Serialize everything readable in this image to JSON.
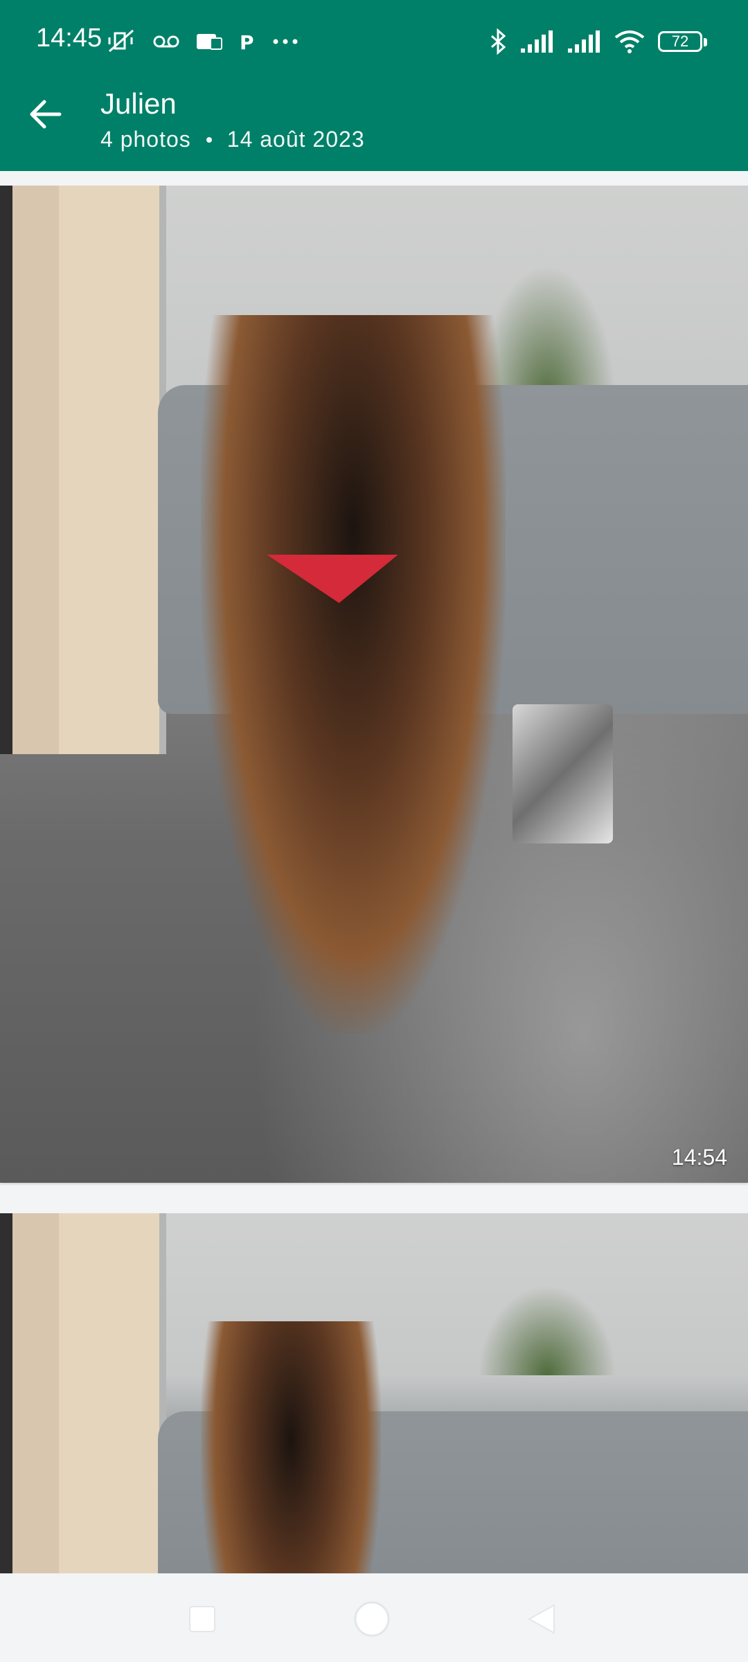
{
  "status_bar": {
    "time": "14:45",
    "left_icons": [
      "mute-vibrate-icon",
      "voicemail-icon",
      "sim-icon",
      "parking-icon",
      "more-icon"
    ],
    "right_icons": [
      "bluetooth-icon",
      "signal-icon",
      "signal-icon",
      "wifi-icon"
    ],
    "battery": "72"
  },
  "app_bar": {
    "background": "#008068",
    "title": "Julien",
    "photo_count": "4 photos",
    "date": "14 août 2023"
  },
  "photos": [
    {
      "time": "14:54",
      "subject": "puppy-photo"
    },
    {
      "subject": "puppy-photo"
    }
  ],
  "nav_bar": {
    "buttons": [
      "recents-button",
      "home-button",
      "back-button"
    ]
  }
}
